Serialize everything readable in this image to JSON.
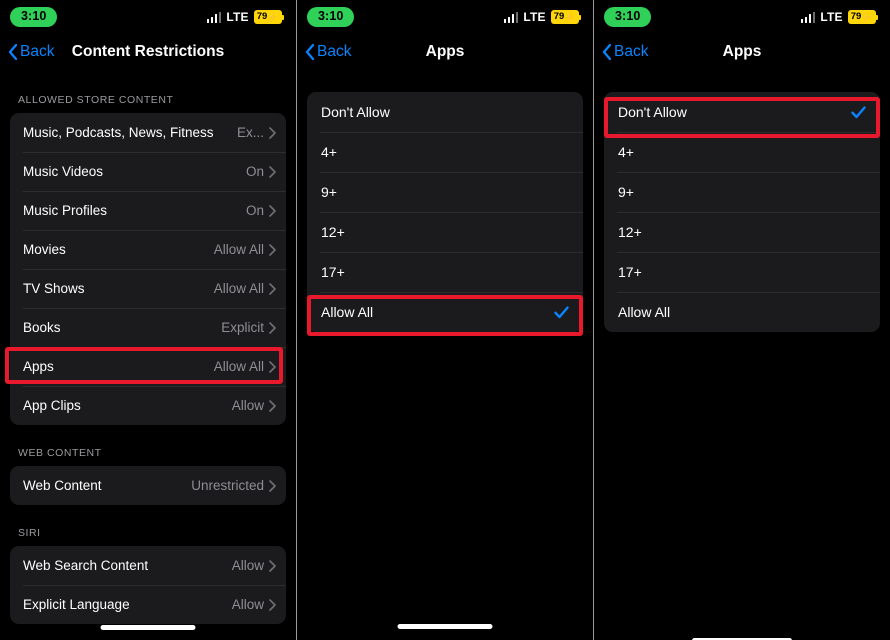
{
  "status": {
    "time": "3:10",
    "network_label": "LTE",
    "battery_level": "79",
    "signal_icon": "cellular-bars-icon",
    "battery_icon": "battery-low-power-icon"
  },
  "panel1": {
    "nav": {
      "back_label": "Back",
      "title": "Content Restrictions",
      "back_icon": "chevron-left-icon"
    },
    "sections": [
      {
        "header": "ALLOWED STORE CONTENT",
        "rows": [
          {
            "label": "Music, Podcasts, News, Fitness",
            "value": "Ex...",
            "highlighted": false
          },
          {
            "label": "Music Videos",
            "value": "On",
            "highlighted": false
          },
          {
            "label": "Music Profiles",
            "value": "On",
            "highlighted": false
          },
          {
            "label": "Movies",
            "value": "Allow All",
            "highlighted": false
          },
          {
            "label": "TV Shows",
            "value": "Allow All",
            "highlighted": false
          },
          {
            "label": "Books",
            "value": "Explicit",
            "highlighted": false
          },
          {
            "label": "Apps",
            "value": "Allow All",
            "highlighted": true
          },
          {
            "label": "App Clips",
            "value": "Allow",
            "highlighted": false
          }
        ]
      },
      {
        "header": "WEB CONTENT",
        "rows": [
          {
            "label": "Web Content",
            "value": "Unrestricted",
            "highlighted": false
          }
        ]
      },
      {
        "header": "SIRI",
        "rows": [
          {
            "label": "Web Search Content",
            "value": "Allow",
            "highlighted": false
          },
          {
            "label": "Explicit Language",
            "value": "Allow",
            "highlighted": false
          }
        ]
      }
    ]
  },
  "panel2": {
    "nav": {
      "back_label": "Back",
      "title": "Apps",
      "back_icon": "chevron-left-icon"
    },
    "options": [
      {
        "label": "Don't Allow",
        "selected": false,
        "highlighted": false
      },
      {
        "label": "4+",
        "selected": false,
        "highlighted": false
      },
      {
        "label": "9+",
        "selected": false,
        "highlighted": false
      },
      {
        "label": "12+",
        "selected": false,
        "highlighted": false
      },
      {
        "label": "17+",
        "selected": false,
        "highlighted": false
      },
      {
        "label": "Allow All",
        "selected": true,
        "highlighted": true
      }
    ]
  },
  "panel3": {
    "nav": {
      "back_label": "Back",
      "title": "Apps",
      "back_icon": "chevron-left-icon"
    },
    "options": [
      {
        "label": "Don't Allow",
        "selected": true,
        "highlighted": true
      },
      {
        "label": "4+",
        "selected": false,
        "highlighted": false
      },
      {
        "label": "9+",
        "selected": false,
        "highlighted": false
      },
      {
        "label": "12+",
        "selected": false,
        "highlighted": false
      },
      {
        "label": "17+",
        "selected": false,
        "highlighted": false
      },
      {
        "label": "Allow All",
        "selected": false,
        "highlighted": false
      }
    ]
  },
  "colors": {
    "accent_blue": "#0a84ff",
    "highlight_red": "#e8192c",
    "time_pill_green": "#30d158",
    "battery_yellow": "#ffd60a",
    "card_bg": "#1b1b1d",
    "page_bg": "#000000",
    "secondary_text": "#8e8e93"
  }
}
